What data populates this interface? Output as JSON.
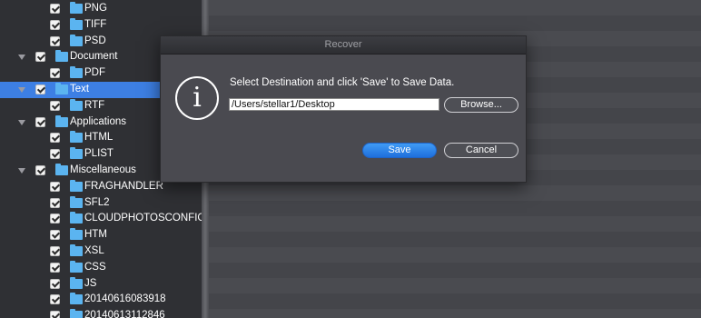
{
  "tree": {
    "items": [
      {
        "label": "PNG",
        "indent": 2,
        "expand": false,
        "selected": false
      },
      {
        "label": "TIFF",
        "indent": 2,
        "expand": false,
        "selected": false
      },
      {
        "label": "PSD",
        "indent": 2,
        "expand": false,
        "selected": false
      },
      {
        "label": "Document",
        "indent": 1,
        "expand": true,
        "selected": false
      },
      {
        "label": "PDF",
        "indent": 2,
        "expand": false,
        "selected": false
      },
      {
        "label": "Text",
        "indent": 1,
        "expand": true,
        "selected": true
      },
      {
        "label": "RTF",
        "indent": 2,
        "expand": false,
        "selected": false
      },
      {
        "label": "Applications",
        "indent": 1,
        "expand": true,
        "selected": false
      },
      {
        "label": "HTML",
        "indent": 2,
        "expand": false,
        "selected": false
      },
      {
        "label": "PLIST",
        "indent": 2,
        "expand": false,
        "selected": false
      },
      {
        "label": "Miscellaneous",
        "indent": 1,
        "expand": true,
        "selected": false
      },
      {
        "label": "FRAGHANDLER",
        "indent": 2,
        "expand": false,
        "selected": false
      },
      {
        "label": "SFL2",
        "indent": 2,
        "expand": false,
        "selected": false
      },
      {
        "label": "CLOUDPHOTOSCONFIGU",
        "indent": 2,
        "expand": false,
        "selected": false
      },
      {
        "label": "HTM",
        "indent": 2,
        "expand": false,
        "selected": false
      },
      {
        "label": "XSL",
        "indent": 2,
        "expand": false,
        "selected": false
      },
      {
        "label": "CSS",
        "indent": 2,
        "expand": false,
        "selected": false
      },
      {
        "label": "JS",
        "indent": 2,
        "expand": false,
        "selected": false
      },
      {
        "label": "20140616083918",
        "indent": 2,
        "expand": false,
        "selected": false
      },
      {
        "label": "20140613112846",
        "indent": 2,
        "expand": false,
        "selected": false
      }
    ]
  },
  "dialog": {
    "title": "Recover",
    "icon": "info-icon",
    "icon_glyph": "i",
    "message": "Select Destination and click 'Save' to Save Data.",
    "path_value": "/Users/stellar1/Desktop",
    "browse_label": "Browse...",
    "save_label": "Save",
    "cancel_label": "Cancel"
  },
  "colors": {
    "accent": "#3d7fe3",
    "folder": "#5bb4f0",
    "primary_button": "#1e6fdc"
  }
}
